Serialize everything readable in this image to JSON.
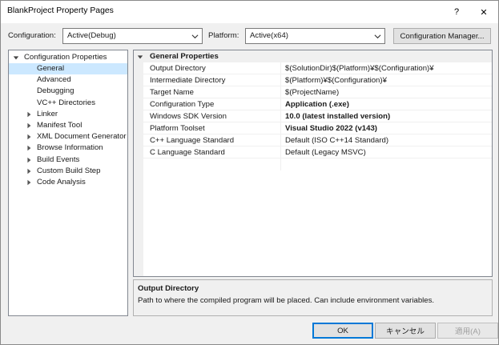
{
  "window": {
    "title": "BlankProject Property Pages",
    "help": "?",
    "close": "✕"
  },
  "config": {
    "configuration_label": "Configuration:",
    "configuration_value": "Active(Debug)",
    "platform_label": "Platform:",
    "platform_value": "Active(x64)",
    "manager_button": "Configuration Manager..."
  },
  "tree": {
    "root": "Configuration Properties",
    "items": [
      {
        "label": "General",
        "selected": true,
        "expandable": false
      },
      {
        "label": "Advanced",
        "expandable": false
      },
      {
        "label": "Debugging",
        "expandable": false
      },
      {
        "label": "VC++ Directories",
        "expandable": false
      },
      {
        "label": "Linker",
        "expandable": true
      },
      {
        "label": "Manifest Tool",
        "expandable": true
      },
      {
        "label": "XML Document Generator",
        "expandable": true
      },
      {
        "label": "Browse Information",
        "expandable": true
      },
      {
        "label": "Build Events",
        "expandable": true
      },
      {
        "label": "Custom Build Step",
        "expandable": true
      },
      {
        "label": "Code Analysis",
        "expandable": true
      }
    ]
  },
  "grid": {
    "category": "General Properties",
    "rows": [
      {
        "name": "Output Directory",
        "value": "$(SolutionDir)$(Platform)¥$(Configuration)¥",
        "bold": false
      },
      {
        "name": "Intermediate Directory",
        "value": "$(Platform)¥$(Configuration)¥",
        "bold": false
      },
      {
        "name": "Target Name",
        "value": "$(ProjectName)",
        "bold": false
      },
      {
        "name": "Configuration Type",
        "value": "Application (.exe)",
        "bold": true
      },
      {
        "name": "Windows SDK Version",
        "value": "10.0 (latest installed version)",
        "bold": true
      },
      {
        "name": "Platform Toolset",
        "value": "Visual Studio 2022 (v143)",
        "bold": true
      },
      {
        "name": "C++ Language Standard",
        "value": "Default (ISO C++14 Standard)",
        "bold": false
      },
      {
        "name": "C Language Standard",
        "value": "Default (Legacy MSVC)",
        "bold": false
      }
    ]
  },
  "description": {
    "title": "Output Directory",
    "text": "Path to where the compiled program will be placed. Can include environment variables."
  },
  "buttons": {
    "ok": "OK",
    "cancel": "キャンセル",
    "apply": "適用(A)"
  },
  "colors": {
    "selection": "#cce8ff",
    "accent": "#0078d7"
  }
}
